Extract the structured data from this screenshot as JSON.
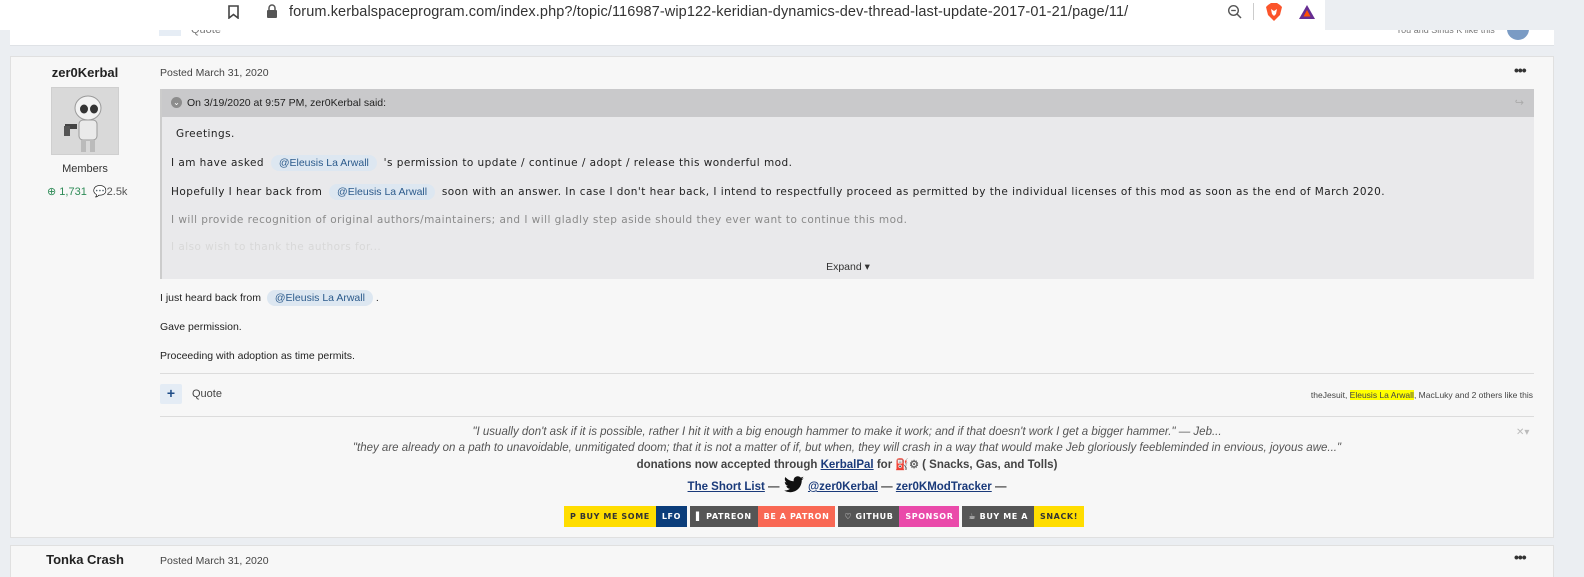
{
  "browser": {
    "url": "forum.kerbalspaceprogram.com/index.php?/topic/116987-wip122-keridian-dynamics-dev-thread-last-update-2017-01-21/page/11/"
  },
  "prev_post": {
    "quote_label": "Quote",
    "likes_text": "You and Sirius K like this"
  },
  "post": {
    "author": {
      "name": "zer0Kerbal",
      "group": "Members",
      "reputation": "1,731",
      "posts": "2.5k"
    },
    "posted": "Posted March 31, 2020",
    "menu_label": "•••",
    "quote": {
      "citation": "On 3/19/2020 at 9:57 PM, zer0Kerbal said:",
      "line1": "Greetings.",
      "line2_a": "I am have asked",
      "mention": "@Eleusis La Arwall",
      "line2_b": "'s permission to update / continue / adopt / release this wonderful mod.",
      "line3_a": "Hopefully I hear back from",
      "line3_b": "soon with an answer. In case I don't hear back, I intend to respectfully proceed as permitted by the individual licenses of this mod as soon as the end of March 2020.",
      "line4": "I will provide recognition of original authors/maintainers; and I will gladly step aside should they ever want to continue this mod.",
      "line5": "I also wish to thank the authors for...",
      "expand_label": "Expand ▾"
    },
    "body": {
      "line1_a": "I just heard back from",
      "mention": "@Eleusis La Arwall",
      "line1_b": ".",
      "line2": "Gave permission.",
      "line3": "Proceeding with adoption as time permits."
    },
    "actions": {
      "plus_label": "+",
      "quote_label": "Quote",
      "likes_a": "theJesuit, ",
      "likes_hl": "Eleusis La Arwall",
      "likes_b": ", MacLuky and 2 others like this"
    },
    "signature": {
      "quote1": "\"I usually don't ask if it is possible, rather I hit it with a big enough hammer to make it work; and if that doesn't work I get a bigger hammer.\"  — Jeb...",
      "quote2": "\"they are already on a path to unavoidable, unmitigated doom; that it is not a matter of if, but when, they will crash in a way that would make Jeb gloriously feebleminded in envious, joyous awe...\"",
      "donations_a": "donations now accepted through ",
      "donations_link": "KerbalPal",
      "donations_b": " for ",
      "donations_c": " ( Snacks, Gas, and Tolls)",
      "shortlist": "The Short List",
      "dash1": " — ",
      "twitter": "@zer0Kerbal",
      "dash2": "  — ",
      "tracker": "zer0KModTracker",
      "dash3": " —",
      "close": "✕▾"
    },
    "badges": [
      {
        "label": "BUY ME SOME",
        "bg": "#ffdd00",
        "fg": "#333333"
      },
      {
        "label": "LFO",
        "bg": "#0b3d7a",
        "fg": "#ffffff"
      },
      {
        "label": "PATREON",
        "bg": "#555555",
        "fg": "#ffffff"
      },
      {
        "label": "BE A PATRON",
        "bg": "#f96854",
        "fg": "#ffffff"
      },
      {
        "label": "GITHUB",
        "bg": "#555555",
        "fg": "#ffffff"
      },
      {
        "label": "SPONSOR",
        "bg": "#ea4aaa",
        "fg": "#ffffff"
      },
      {
        "label": "BUY ME A",
        "bg": "#555555",
        "fg": "#ffffff"
      },
      {
        "label": "SNACK!",
        "bg": "#ffdd00",
        "fg": "#333333"
      }
    ]
  },
  "next_post": {
    "author": "Tonka Crash",
    "posted": "Posted March 31, 2020",
    "menu_label": "•••"
  },
  "colors": {
    "mention_bg": "#dde7f1",
    "mention_fg": "#2c5b8c",
    "highlight": "#ffff00",
    "reputation": "#2e8b57"
  }
}
